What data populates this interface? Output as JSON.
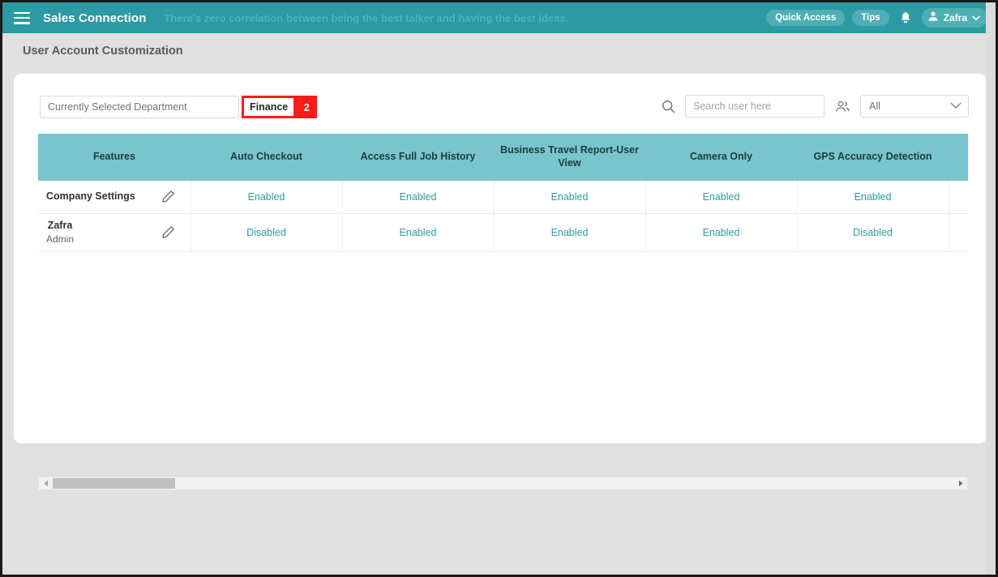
{
  "appbar": {
    "menu_icon": "hamburger-icon",
    "brand": "Sales Connection",
    "tagline": "There's zero correlation between being the best talker and having the best ideas.",
    "quick_access_label": "Quick Access",
    "tips_label": "Tips",
    "bell_icon": "bell-icon",
    "user_name": "Zafra",
    "user_icon": "person-icon",
    "chevron_icon": "chevron-down-icon",
    "bg_color": "#2b9aa3",
    "pill_color": "#50aeb5"
  },
  "page": {
    "title": "User Account Customization",
    "bg_color": "#e0e0e0"
  },
  "toolbar": {
    "department_label": "Currently Selected Department",
    "department_value": "Finance",
    "step_badge": "2",
    "highlight_color": "#ff1a1a",
    "search_icon": "search-icon",
    "search_placeholder": "Search user here",
    "search_value": "",
    "people_icon": "people-icon",
    "filter_selected": "All",
    "filter_chevron_icon": "chevron-down-icon"
  },
  "table": {
    "header_bg": "#78c5cd",
    "columns": [
      "Features",
      "Auto Checkout",
      "Access Full Job History",
      "Business Travel Report-User View",
      "Camera Only",
      "GPS Accuracy Detection"
    ],
    "edit_icon": "pencil-icon",
    "rows": [
      {
        "name": "Company Settings",
        "subtitle": "",
        "values": [
          "Enabled",
          "Enabled",
          "Enabled",
          "Enabled",
          "Enabled"
        ]
      },
      {
        "name": "Zafra",
        "subtitle": "Admin",
        "values": [
          "Disabled",
          "Enabled",
          "Enabled",
          "Enabled",
          "Disabled"
        ]
      }
    ],
    "enabled_color": "#2a9d9d",
    "disabled_color": "#ef476f"
  },
  "scrollbar": {
    "left_arrow_icon": "arrow-left-icon",
    "right_arrow_icon": "arrow-right-icon"
  }
}
